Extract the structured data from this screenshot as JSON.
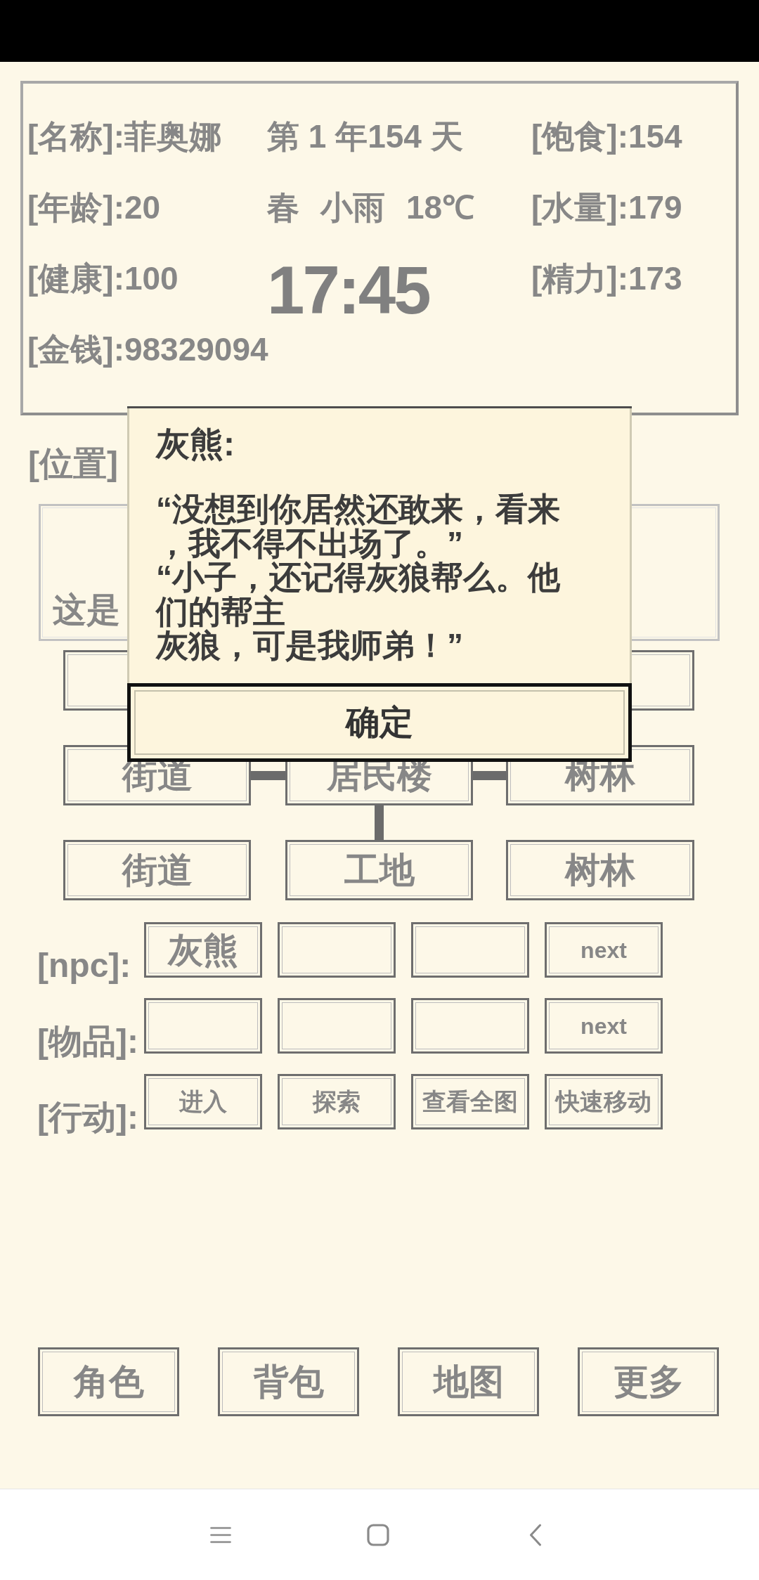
{
  "stats_panel": {
    "left": [
      "[名称]:菲奥娜",
      "[年龄]:20",
      "[健康]:100",
      "[金钱]:98329094"
    ],
    "date": "第 1 年154 天",
    "season": "春",
    "weather": "小雨",
    "temperature": "18℃",
    "clock": "17:45",
    "right": [
      "[饱食]:154",
      "[水量]:179",
      "[精力]:173"
    ]
  },
  "location": {
    "label": "[位置]"
  },
  "description": "这是",
  "map": {
    "rows": [
      [
        {
          "kind": "tile"
        },
        {
          "kind": "blank"
        },
        {
          "kind": "tile"
        }
      ],
      [
        {
          "kind": "tile",
          "label": "街道",
          "link_right": true,
          "link_down": false
        },
        {
          "kind": "tile",
          "label": "居民楼",
          "link_right": true,
          "link_down": true
        },
        {
          "kind": "tile",
          "label": "树林",
          "link_right": false,
          "link_down": false
        }
      ],
      [
        {
          "kind": "tile",
          "label": "街道",
          "link_right": false,
          "link_down": false
        },
        {
          "kind": "tile",
          "label": "工地",
          "link_right": false,
          "link_down": false
        },
        {
          "kind": "tile",
          "label": "树林",
          "link_right": false,
          "link_down": false
        }
      ]
    ]
  },
  "npc": {
    "label": "[npc]:",
    "slots": [
      {
        "kind": "filled",
        "text": "灰熊"
      },
      {
        "kind": "empty"
      },
      {
        "kind": "empty"
      }
    ],
    "next": "next"
  },
  "items": {
    "label": "[物品]:",
    "slots": [
      {
        "kind": "empty"
      },
      {
        "kind": "empty"
      },
      {
        "kind": "empty"
      }
    ],
    "next": "next"
  },
  "actions": {
    "label": "[行动]:",
    "buttons": [
      "进入",
      "探索",
      "查看全图",
      "快速移动"
    ]
  },
  "bottom_menu": [
    "角色",
    "背包",
    "地图",
    "更多"
  ],
  "dialog": {
    "speaker": "灰熊:",
    "paragraphs": [
      "“没想到你居然还敢来，看来，我不得不出场了。”",
      "“小子，还记得灰狼帮么。他们的帮主",
      "灰狼，可是我师弟！”"
    ],
    "button": "确定"
  }
}
